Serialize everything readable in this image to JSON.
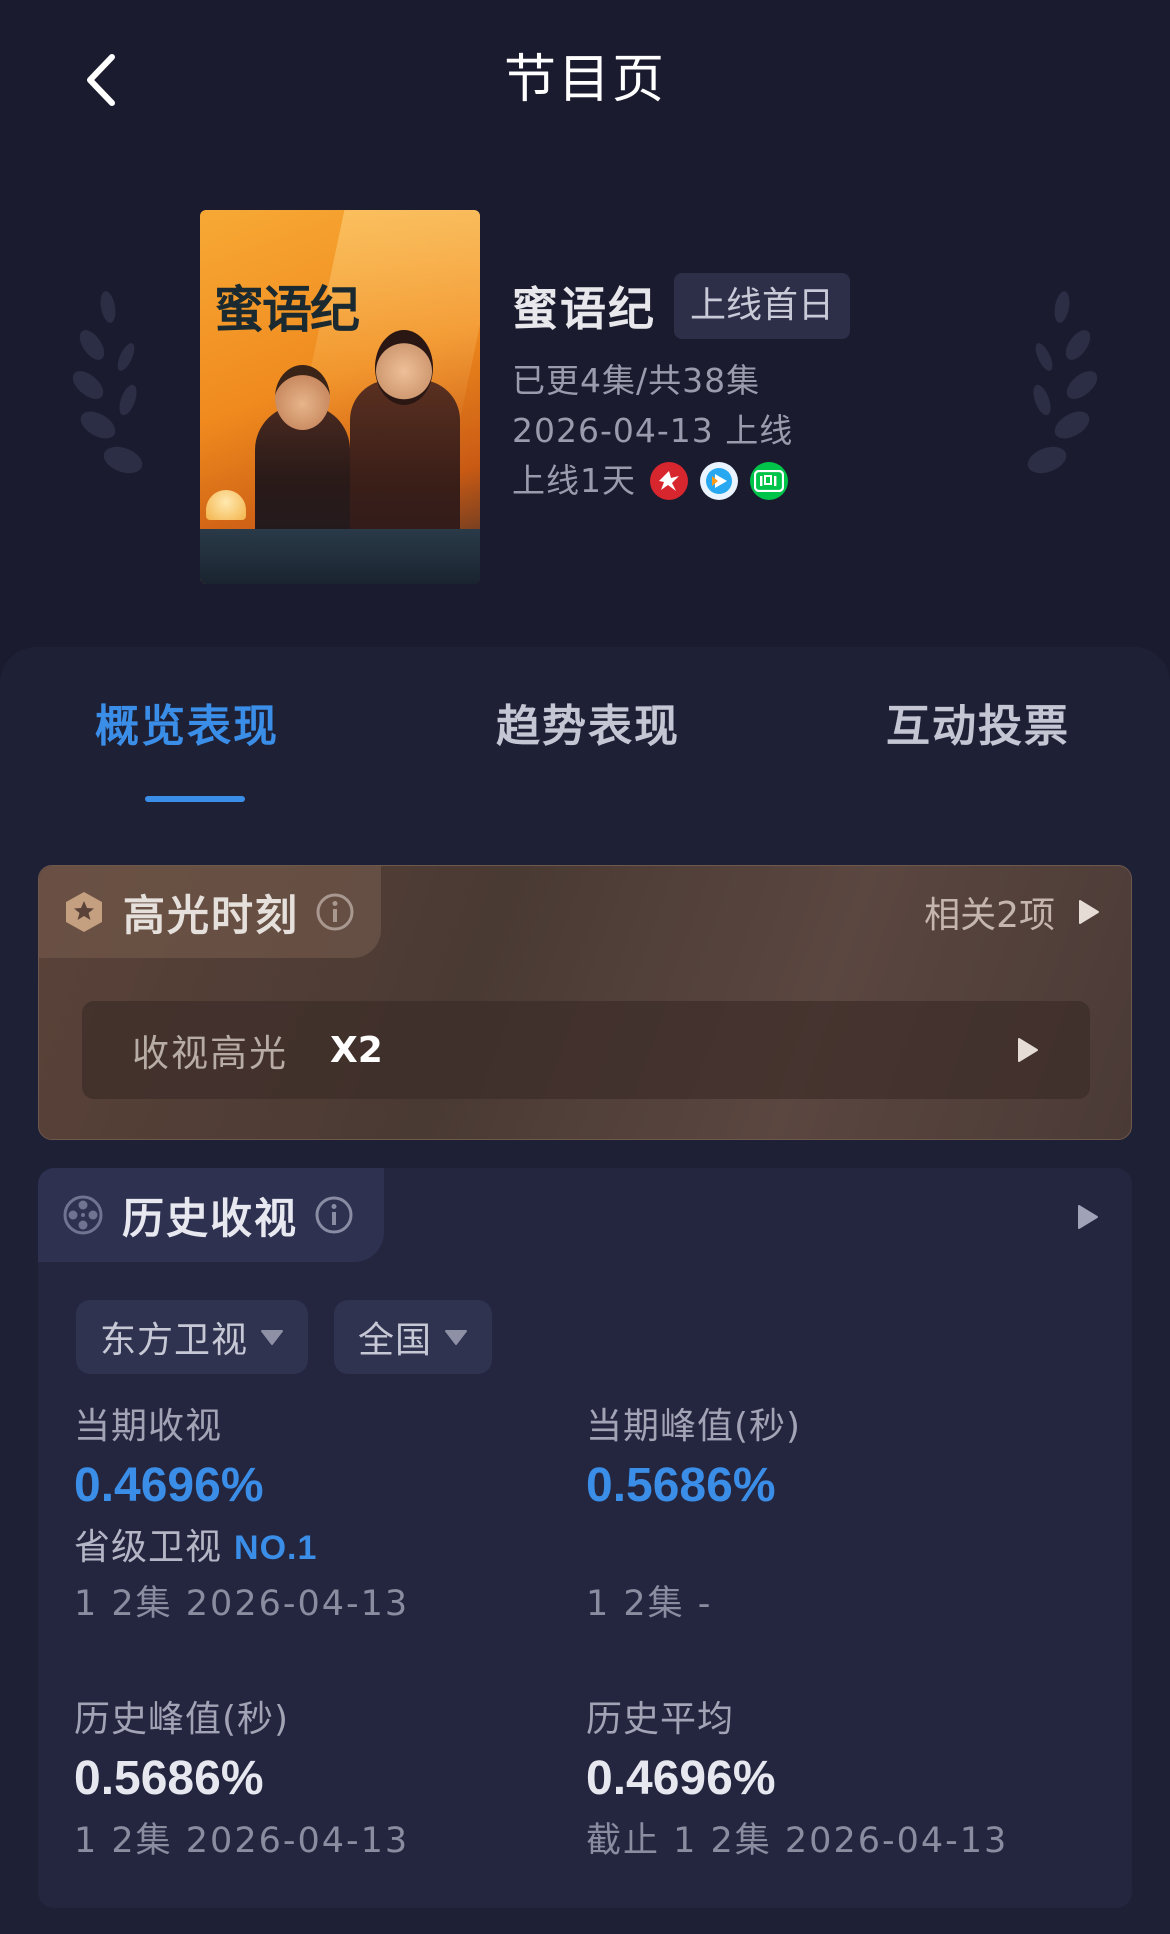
{
  "header": {
    "title": "节目页"
  },
  "program": {
    "name": "蜜语纪",
    "tag": "上线首日",
    "episodes": "已更4集/共38集",
    "release": "2026-04-13 上线",
    "days_online": "上线1天",
    "poster_title": "蜜语纪",
    "platforms": [
      "dragon-tv-icon",
      "tencent-video-icon",
      "iqiyi-icon"
    ]
  },
  "tabs": [
    {
      "label": "概览表现",
      "active": true
    },
    {
      "label": "趋势表现",
      "active": false
    },
    {
      "label": "互动投票",
      "active": false
    }
  ],
  "highlight": {
    "title": "高光时刻",
    "more": "相关2项",
    "row_label": "收视高光",
    "row_value": "X2"
  },
  "history": {
    "title": "历史收视",
    "filters": [
      {
        "label": "东方卫视"
      },
      {
        "label": "全国"
      }
    ],
    "current": {
      "label": "当期收视",
      "value": "0.4696%",
      "rank_prefix": "省级卫视",
      "rank": "NO.1",
      "sub": "1 2集 2026-04-13"
    },
    "current_peak": {
      "label": "当期峰值(秒)",
      "value": "0.5686%",
      "sub": "1 2集 -"
    },
    "history_peak": {
      "label": "历史峰值(秒)",
      "value": "0.5686%",
      "sub": "1 2集 2026-04-13"
    },
    "history_avg": {
      "label": "历史平均",
      "value": "0.4696%",
      "sub": "截止 1 2集 2026-04-13"
    }
  },
  "colors": {
    "background": "#1a1b2e",
    "accent": "#3b8ee8",
    "highlight_card": "#4a3a34"
  }
}
